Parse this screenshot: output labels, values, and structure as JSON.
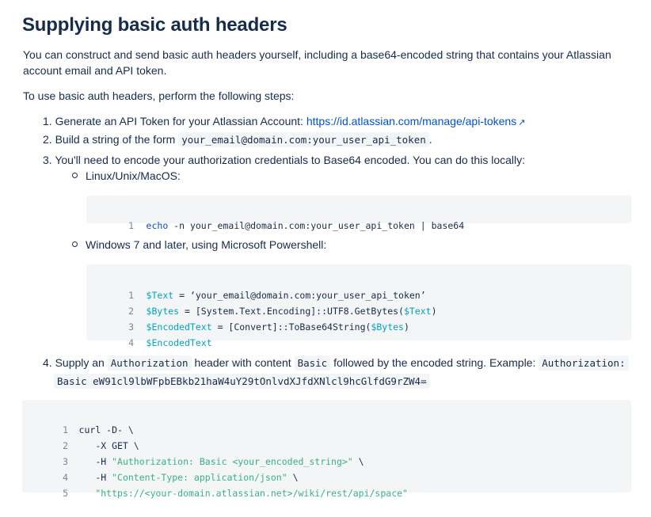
{
  "title": "Supplying basic auth headers",
  "intro_line1": "You can construct and send basic auth headers yourself, including a base64-encoded string that contains your Atlassian",
  "intro_line2": "account email and API token.",
  "steps_intro": "To use basic auth headers, perform the following steps:",
  "step1": {
    "prefix": "1. Generate an API Token for your Atlassian Account: ",
    "link_text": "https://id.atlassian.com/manage/api-tokens",
    "icon": "external-link-icon",
    "icon_glyph": "↗"
  },
  "step2": {
    "prefix": "2. Build a string of the form ",
    "code": "your_email@domain.com:your_user_api_token",
    "suffix": "."
  },
  "step3": {
    "text": "3. You'll need to encode your authorization credentials to Base64 encoded. You can do this locally:",
    "bullet1": "Linux/Unix/MacOS:",
    "bullet2": "Windows 7 and later, using Microsoft Powershell:"
  },
  "code1": {
    "lines": [
      {
        "num": "1",
        "cmd": "echo",
        "rest": " -n your_email@domain.com:your_user_api_token | base64"
      }
    ]
  },
  "code2": {
    "lines": [
      {
        "num": "1",
        "v1": "$Text",
        "t1": " = ‘your_email@domain.com:your_user_api_token’",
        "v2": "",
        "t2": ""
      },
      {
        "num": "2",
        "v1": "$Bytes",
        "t1": " = [System.Text.Encoding]::UTF8.GetBytes(",
        "v2": "$Text",
        "t2": ")"
      },
      {
        "num": "3",
        "v1": "$EncodedText",
        "t1": " = [Convert]::ToBase64String(",
        "v2": "$Bytes",
        "t2": ")"
      },
      {
        "num": "4",
        "v1": "$EncodedText",
        "t1": "",
        "v2": "",
        "t2": ""
      }
    ]
  },
  "step4": {
    "prefix": "4. Supply an ",
    "code1": "Authorization",
    "mid1": " header with content ",
    "code2": "Basic",
    "mid2": " followed by the encoded string. Example: ",
    "code3": "Authorization:",
    "code4": "Basic eW91cl9lbWFpbEBkb21haW4uY29tOnlvdXJfdXNlcl9hcGlfdG9rZW4="
  },
  "code3": {
    "lines": [
      {
        "num": "1",
        "pre": "curl -D- \\",
        "str": "",
        "post": ""
      },
      {
        "num": "2",
        "pre": "   -X GET \\",
        "str": "",
        "post": ""
      },
      {
        "num": "3",
        "pre": "   -H ",
        "str": "\"Authorization: Basic <your_encoded_string>\"",
        "post": " \\"
      },
      {
        "num": "4",
        "pre": "   -H ",
        "str": "\"Content-Type: application/json\"",
        "post": " \\"
      },
      {
        "num": "5",
        "pre": "   ",
        "str": "\"https://<your-domain.atlassian.net>/wiki/rest/api/space\"",
        "post": ""
      }
    ]
  },
  "colors": {
    "text": "#172b4d",
    "link": "#0052cc",
    "code_bg": "#f4f5f7",
    "string": "#36b37e",
    "variable": "#00a3bf",
    "line_number": "#7a869a"
  }
}
